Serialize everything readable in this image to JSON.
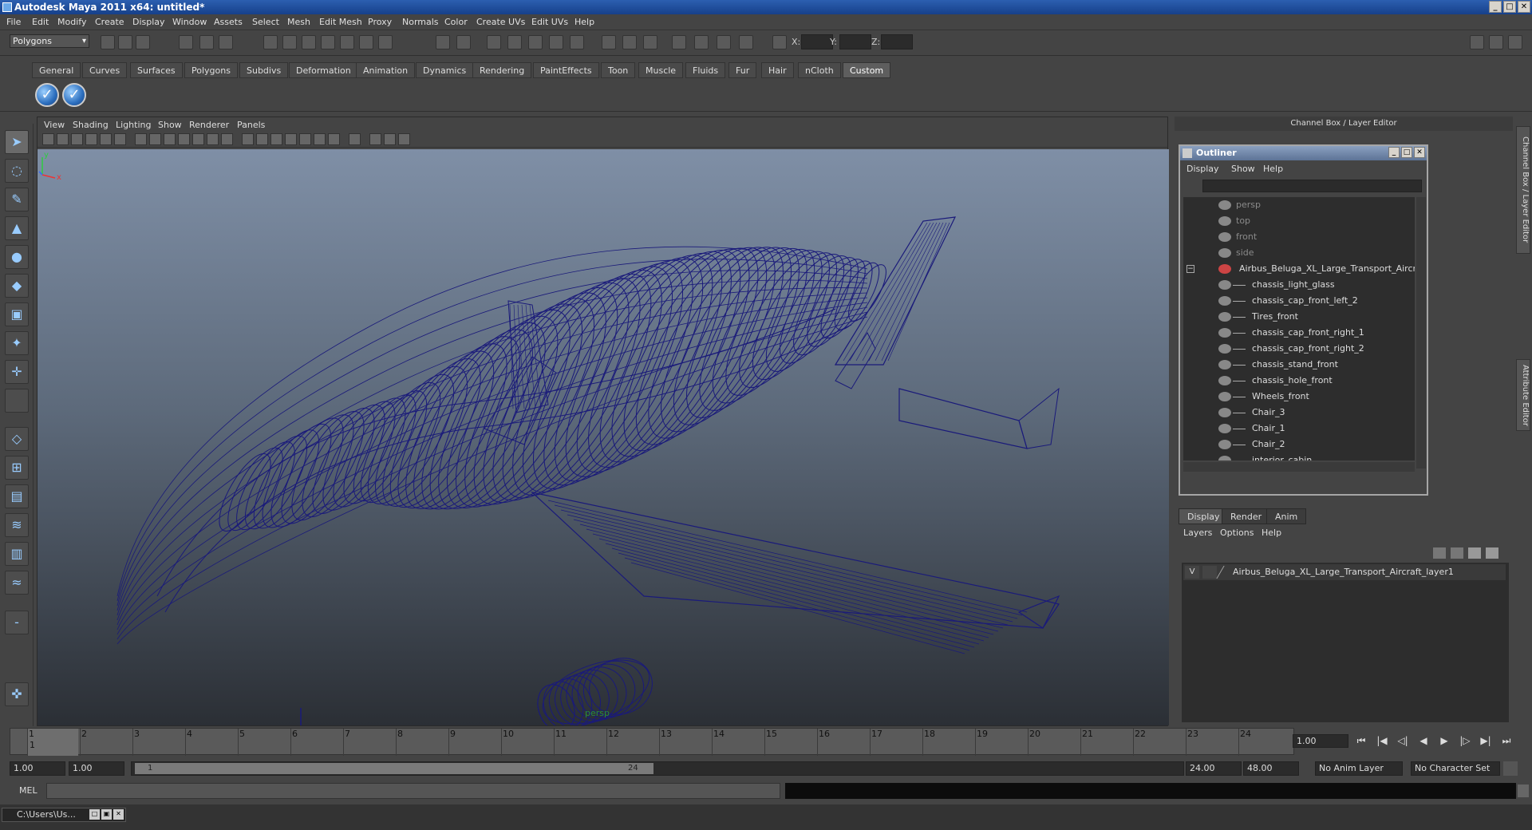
{
  "window": {
    "title": "Autodesk Maya 2011 x64: untitled*"
  },
  "menubar": [
    "File",
    "Edit",
    "Modify",
    "Create",
    "Display",
    "Window",
    "Assets",
    "Select",
    "Mesh",
    "Edit Mesh",
    "Proxy",
    "Normals",
    "Color",
    "Create UVs",
    "Edit UVs",
    "Help"
  ],
  "statusline": {
    "menu_set": "Polygons",
    "x_label": "X:",
    "y_label": "Y:",
    "z_label": "Z:"
  },
  "shelf_tabs": [
    "General",
    "Curves",
    "Surfaces",
    "Polygons",
    "Subdivs",
    "Deformation",
    "Animation",
    "Dynamics",
    "Rendering",
    "PaintEffects",
    "Toon",
    "Muscle",
    "Fluids",
    "Fur",
    "Hair",
    "nCloth",
    "Custom"
  ],
  "shelf_active_tab": "Custom",
  "viewport": {
    "menu": [
      "View",
      "Shading",
      "Lighting",
      "Show",
      "Renderer",
      "Panels"
    ],
    "camera": "persp",
    "axis_y": "y",
    "axis_x": "x",
    "wire_color": "#1a1a7a"
  },
  "channel_box": {
    "title": "Channel Box / Layer Editor"
  },
  "side_tabs": [
    "Channel Box / Layer Editor",
    "Attribute Editor"
  ],
  "outliner": {
    "title": "Outliner",
    "menu": [
      "Display",
      "Show",
      "Help"
    ],
    "cameras": [
      "persp",
      "top",
      "front",
      "side"
    ],
    "root": "Airbus_Beluga_XL_Large_Transport_Aircraft",
    "children": [
      "chassis_light_glass",
      "chassis_cap_front_left_2",
      "Tires_front",
      "chassis_cap_front_right_1",
      "chassis_cap_front_right_2",
      "chassis_stand_front",
      "chassis_hole_front",
      "Wheels_front",
      "Chair_3",
      "Chair_1",
      "Chair_2",
      "interior_cabin"
    ]
  },
  "layer_editor": {
    "tabs": [
      "Display",
      "Render",
      "Anim"
    ],
    "menu": [
      "Layers",
      "Options",
      "Help"
    ],
    "layer": {
      "visible": "V",
      "name": "Airbus_Beluga_XL_Large_Transport_Aircraft_layer1"
    }
  },
  "timeline": {
    "ticks": [
      "1",
      "2",
      "3",
      "4",
      "5",
      "6",
      "7",
      "8",
      "9",
      "10",
      "11",
      "12",
      "13",
      "14",
      "15",
      "16",
      "17",
      "18",
      "19",
      "20",
      "21",
      "22",
      "23",
      "24"
    ],
    "current_frame_marker": "1",
    "current_frame": "1.00"
  },
  "range": {
    "start": "1.00",
    "playback_start": "1.00",
    "slider_start": "1",
    "slider_end": "24",
    "playback_end": "24.00",
    "end": "48.00",
    "anim_layer": "No Anim Layer",
    "character_set": "No Character Set"
  },
  "command_line": {
    "label": "MEL"
  },
  "taskbar": {
    "item": "C:\\Users\\Us..."
  }
}
